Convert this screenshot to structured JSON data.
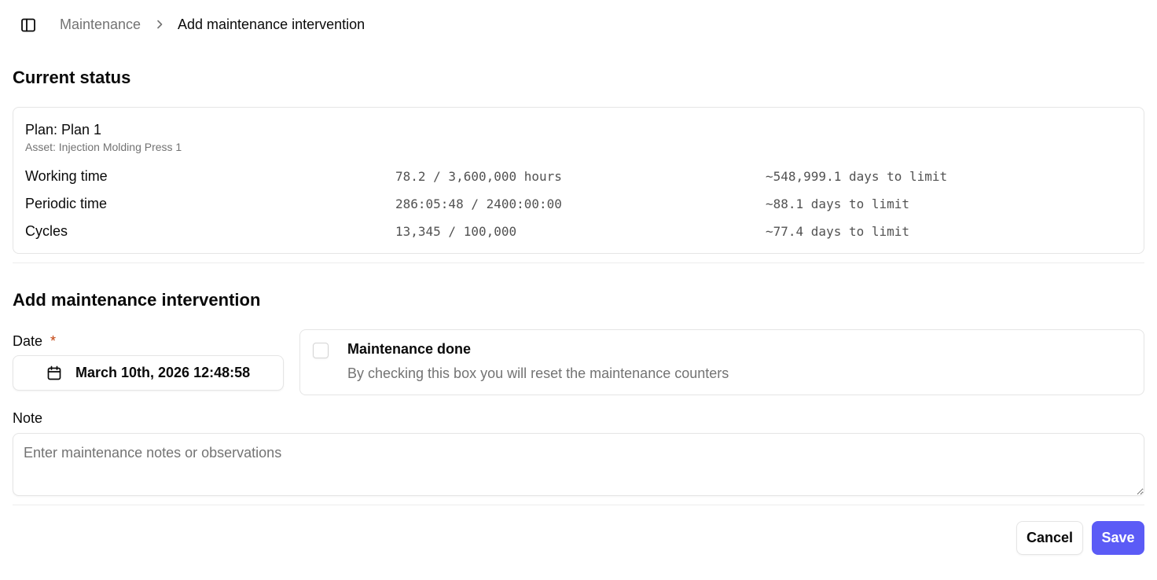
{
  "breadcrumb": {
    "parent": "Maintenance",
    "current": "Add maintenance intervention"
  },
  "current_status": {
    "heading": "Current status",
    "plan_label": "Plan: Plan 1",
    "asset_label": "Asset: Injection Molding Press 1",
    "metrics": [
      {
        "label": "Working time",
        "value": "78.2 / 3,600,000 hours",
        "limit": "~548,999.1 days to limit"
      },
      {
        "label": "Periodic time",
        "value": "286:05:48 / 2400:00:00",
        "limit": "~88.1 days to limit"
      },
      {
        "label": "Cycles",
        "value": "13,345 / 100,000",
        "limit": "~77.4 days to limit"
      }
    ]
  },
  "form": {
    "heading": "Add maintenance intervention",
    "date_label": "Date",
    "required_mark": "*",
    "date_value": "March 10th, 2026 12:48:58",
    "done_checked": false,
    "done_title": "Maintenance done",
    "done_description": "By checking this box you will reset the maintenance counters",
    "note_label": "Note",
    "note_placeholder": "Enter maintenance notes or observations",
    "note_value": ""
  },
  "actions": {
    "cancel": "Cancel",
    "save": "Save"
  },
  "colors": {
    "primary": "#5b5bf6",
    "required": "#c2410c",
    "muted_text": "#737373",
    "border": "#e5e5e5"
  },
  "icons": {
    "sidebar_toggle": "panel-left-icon",
    "breadcrumb_separator": "chevron-right-icon",
    "date": "calendar-icon"
  }
}
